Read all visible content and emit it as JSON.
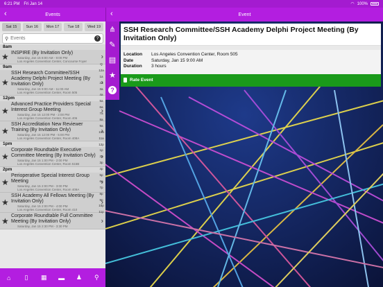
{
  "status": {
    "time": "6:21 PM",
    "date": "Fri Jan 14",
    "battery": "100%"
  },
  "left_nav": {
    "title": "Events"
  },
  "days": [
    "Sat 15",
    "Sun 16",
    "Mon 17",
    "Tue 18",
    "Wed 19"
  ],
  "search": {
    "placeholder": "Events"
  },
  "list": [
    {
      "hour": "8am",
      "events": [
        {
          "title": "INSPIRE (By Invitation Only)",
          "meta1": "Saturday, Jan 15 8:00 AM - 9:00 PM",
          "meta2": "Los Angeles Convention Center, Concourse Foyer"
        }
      ]
    },
    {
      "hour": "9am",
      "events": [
        {
          "title": "SSH Research Committee/SSH Academy Delphi Project Meeting (By Invitation Only)",
          "meta1": "Saturday, Jan 15 9:00 AM - 11:00 AM",
          "meta2": "Los Angeles Convention Center, Room 505"
        }
      ]
    },
    {
      "hour": "12pm",
      "events": [
        {
          "title": "Advanced Practice Providers Special Interest Group Meeting",
          "meta1": "Saturday, Jan 15 12:00 PM - 2:00 PM",
          "meta2": "Los Angeles Convention Center, Room 406"
        },
        {
          "title": "SSH Accreditation New Reviewer Training (By Invitation Only)",
          "meta1": "Saturday, Jan 15 12:00 PM - 5:00 PM",
          "meta2": "Los Angeles Convention Center, Room 408A"
        }
      ]
    },
    {
      "hour": "1pm",
      "events": [
        {
          "title": "Corporate Roundtable Executive Committee Meeting (By Invitation Only)",
          "meta1": "Saturday, Jan 15 1:00 PM - 2:00 PM",
          "meta2": "Los Angeles Convention Center, Room 515B"
        }
      ]
    },
    {
      "hour": "2pm",
      "events": [
        {
          "title": "Perioperative Special Interest Group Meeting",
          "meta1": "Saturday, Jan 15 2:00 PM - 3:00 PM",
          "meta2": "Los Angeles Convention Center, Room 409A"
        },
        {
          "title": "SSH Academy All Fellows Meeting (By Invitation Only)",
          "meta1": "Saturday, Jan 15 2:00 PM - 4:00 PM",
          "meta2": "Los Angeles Convention Center, Room 410"
        },
        {
          "title": "Corporate Roundtable Full Committee Meeting (By Invitation Only)",
          "meta1": "Saturday, Jan 15 2:30 PM - 3:30 PM",
          "meta2": ""
        }
      ]
    }
  ],
  "az_index": [
    "12a",
    "1a",
    "2a",
    "3a",
    "4a",
    "5a",
    "6a",
    "7a",
    "8a",
    "9a",
    "10a",
    "11a",
    "12p",
    "1p",
    "2p",
    "3p",
    "4p",
    "5p",
    "6p",
    "7p",
    "8p",
    "9p",
    "10p",
    "11p"
  ],
  "az_prefix": "Q",
  "right_nav": {
    "title": "Event"
  },
  "event": {
    "title": "SSH Research Committee/SSH Academy Delphi Project Meeting (By Invitation Only)",
    "location_label": "Location",
    "location": "Los Angeles Convention Center, Room 505",
    "date_label": "Date",
    "date": "Saturday, Jan 15 9:00 AM",
    "duration_label": "Duration",
    "duration": "3 hours",
    "rate_label": "Rate Event"
  },
  "colors": {
    "accent": "#b31ee0",
    "rate_green": "#1a9a1a"
  }
}
